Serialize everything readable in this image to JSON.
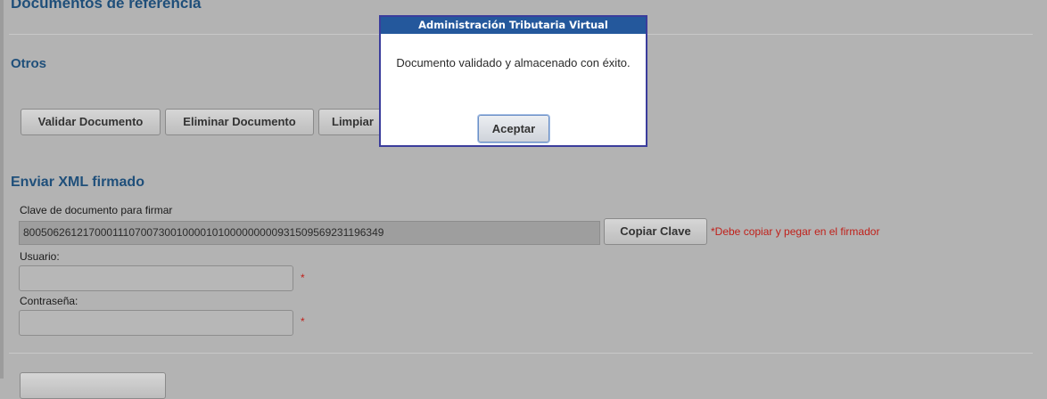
{
  "sections": {
    "documentos_referencia": "Documentos de referencia",
    "otros": "Otros",
    "enviar_xml": "Enviar XML firmado"
  },
  "actions": {
    "validar": "Validar Documento",
    "eliminar": "Eliminar Documento",
    "limpiar": "Limpiar"
  },
  "form": {
    "clave_label": "Clave de documento para firmar",
    "clave_value": "8005062612170001110700730010000101000000000931509569231196349",
    "copiar_button": "Copiar Clave",
    "copiar_note": "*Debe copiar y pegar en el firmador",
    "usuario_label": "Usuario:",
    "usuario_value": "",
    "contrasena_label": "Contraseña:",
    "contrasena_value": "",
    "required_mark": "*"
  },
  "dialog": {
    "title": "Administración Tributaria Virtual",
    "message": "Documento validado y almacenado con éxito.",
    "ok_button": "Aceptar"
  },
  "colors": {
    "overlay_bg": "#b3b3b3",
    "heading": "#1f4f7a",
    "dialog_title_bg": "#24589c",
    "required": "#c0201a"
  }
}
